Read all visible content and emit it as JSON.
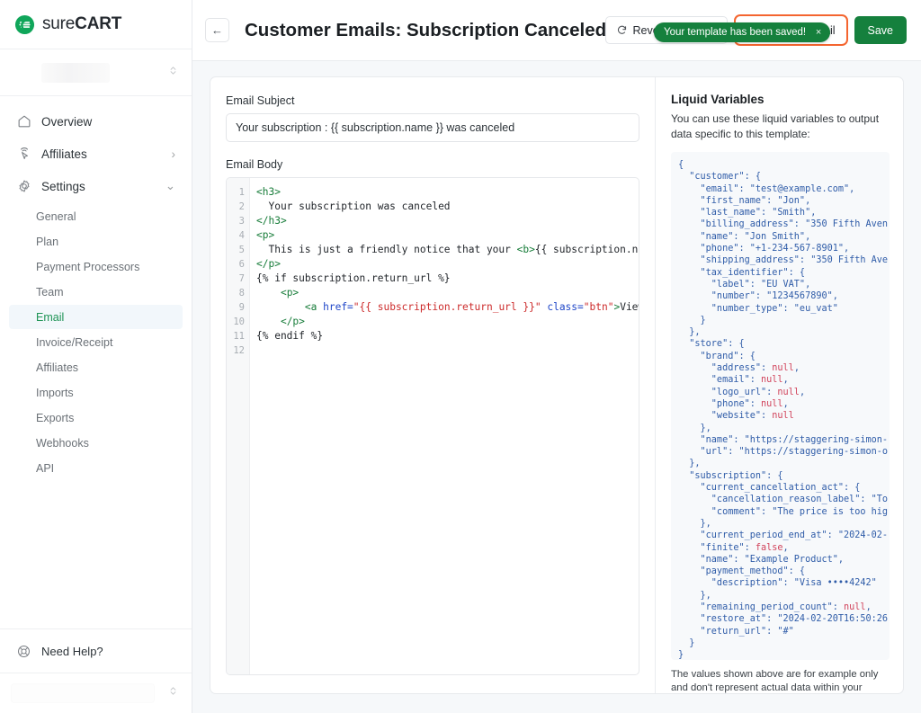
{
  "sidebar": {
    "brand": {
      "name_light": "sure",
      "name_bold": "CART",
      "logo_icon": "surecart-logo-icon"
    },
    "store_selector": {
      "icon": "chevron-up-down-icon",
      "value": ""
    },
    "nav": [
      {
        "label": "Overview",
        "icon": "home-icon",
        "chevron": ""
      },
      {
        "label": "Affiliates",
        "icon": "affiliates-cursor-icon",
        "chevron": "›"
      },
      {
        "label": "Settings",
        "icon": "gear-icon",
        "chevron": "⌄"
      }
    ],
    "sub_items": [
      {
        "label": "General",
        "active": false
      },
      {
        "label": "Plan",
        "active": false
      },
      {
        "label": "Payment Processors",
        "active": false
      },
      {
        "label": "Team",
        "active": false
      },
      {
        "label": "Email",
        "active": true
      },
      {
        "label": "Invoice/Receipt",
        "active": false
      },
      {
        "label": "Affiliates",
        "active": false
      },
      {
        "label": "Imports",
        "active": false
      },
      {
        "label": "Exports",
        "active": false
      },
      {
        "label": "Webhooks",
        "active": false
      },
      {
        "label": "API",
        "active": false
      }
    ],
    "help": {
      "label": "Need Help?",
      "icon": "lifebuoy-icon"
    },
    "bottom_selector": {
      "icon": "chevron-up-down-icon"
    }
  },
  "topbar": {
    "back_label": "←",
    "title": "Customer Emails: Subscription Canceled",
    "toast": {
      "message": "Your template has been saved!",
      "close_label": "×",
      "color": "#15803d"
    },
    "revert_button": "Revert to Default",
    "revert_icon": "refresh-icon",
    "preview_button": "Preview Email",
    "preview_icon": "eye-icon",
    "preview_focus_color": "#f4652f",
    "save_button": "Save",
    "save_color": "#15803d"
  },
  "editor": {
    "subject_label": "Email Subject",
    "subject_value": "Your subscription : {{ subscription.name }} was canceled",
    "subject_placeholder": "Email subject",
    "body_label": "Email Body",
    "line_numbers": [
      "1",
      "2",
      "3",
      "4",
      "5",
      "6",
      "7",
      "8",
      "9",
      "10",
      "11",
      "12"
    ],
    "body_lines": [
      {
        "n": 1,
        "segments": [
          {
            "t": "<h3>",
            "c": "tag"
          }
        ]
      },
      {
        "n": 2,
        "segments": [
          {
            "t": "  Your subscription was canceled",
            "c": "txt"
          }
        ]
      },
      {
        "n": 3,
        "segments": [
          {
            "t": "</h3>",
            "c": "tag"
          }
        ]
      },
      {
        "n": 4,
        "segments": [
          {
            "t": "<p>",
            "c": "tag"
          }
        ]
      },
      {
        "n": 5,
        "segments": [
          {
            "t": "  This is just a friendly notice that your ",
            "c": "txt"
          },
          {
            "t": "<b>",
            "c": "tag"
          },
          {
            "t": "{{ subscription.name }}",
            "c": "txt"
          },
          {
            "t": "</",
            "c": "tag"
          }
        ]
      },
      {
        "n": 6,
        "segments": [
          {
            "t": "</p>",
            "c": "tag"
          }
        ]
      },
      {
        "n": 7,
        "segments": [
          {
            "t": "{% if subscription.return_url %}",
            "c": "txt"
          }
        ]
      },
      {
        "n": 8,
        "segments": [
          {
            "t": "    ",
            "c": "txt"
          },
          {
            "t": "<p>",
            "c": "tag"
          }
        ]
      },
      {
        "n": 9,
        "segments": [
          {
            "t": "        ",
            "c": "txt"
          },
          {
            "t": "<a ",
            "c": "tag"
          },
          {
            "t": "href=",
            "c": "attr"
          },
          {
            "t": "\"{{ subscription.return_url }}\"",
            "c": "str"
          },
          {
            "t": " class=",
            "c": "attr"
          },
          {
            "t": "\"btn\"",
            "c": "str"
          },
          {
            "t": ">",
            "c": "tag"
          },
          {
            "t": "View Subscri",
            "c": "txt"
          }
        ]
      },
      {
        "n": 10,
        "segments": [
          {
            "t": "    ",
            "c": "txt"
          },
          {
            "t": "</p>",
            "c": "tag"
          }
        ]
      },
      {
        "n": 11,
        "segments": [
          {
            "t": "{% endif %}",
            "c": "txt"
          }
        ]
      },
      {
        "n": 12,
        "segments": [
          {
            "t": "",
            "c": "txt"
          }
        ]
      }
    ]
  },
  "variables": {
    "title": "Liquid Variables",
    "description": "You can use these liquid variables to output data specific to this template:",
    "json_lines": [
      "{",
      "  \"customer\": {",
      "    \"email\": \"test@example.com\",",
      "    \"first_name\": \"Jon\",",
      "    \"last_name\": \"Smith\",",
      "    \"billing_address\": \"350 Fifth Aven",
      "    \"name\": \"Jon Smith\",",
      "    \"phone\": \"+1-234-567-8901\",",
      "    \"shipping_address\": \"350 Fifth Ave",
      "    \"tax_identifier\": {",
      "      \"label\": \"EU VAT\",",
      "      \"number\": \"1234567890\",",
      "      \"number_type\": \"eu_vat\"",
      "    }",
      "  },",
      "  \"store\": {",
      "    \"brand\": {",
      "      \"address\": null,",
      "      \"email\": null,",
      "      \"logo_url\": null,",
      "      \"phone\": null,",
      "      \"website\": null",
      "    },",
      "    \"name\": \"https://staggering-simon-",
      "    \"url\": \"https://staggering-simon-o",
      "  },",
      "  \"subscription\": {",
      "    \"current_cancellation_act\": {",
      "      \"cancellation_reason_label\": \"To",
      "      \"comment\": \"The price is too hig",
      "    },",
      "    \"current_period_end_at\": \"2024-02-",
      "    \"finite\": false,",
      "    \"name\": \"Example Product\",",
      "    \"payment_method\": {",
      "      \"description\": \"Visa ••••4242\"",
      "    },",
      "    \"remaining_period_count\": null,",
      "    \"restore_at\": \"2024-02-20T16:50:26",
      "    \"return_url\": \"#\"",
      "  }",
      "}"
    ],
    "note": "The values shown above are for example only and don't represent actual data within your store."
  }
}
